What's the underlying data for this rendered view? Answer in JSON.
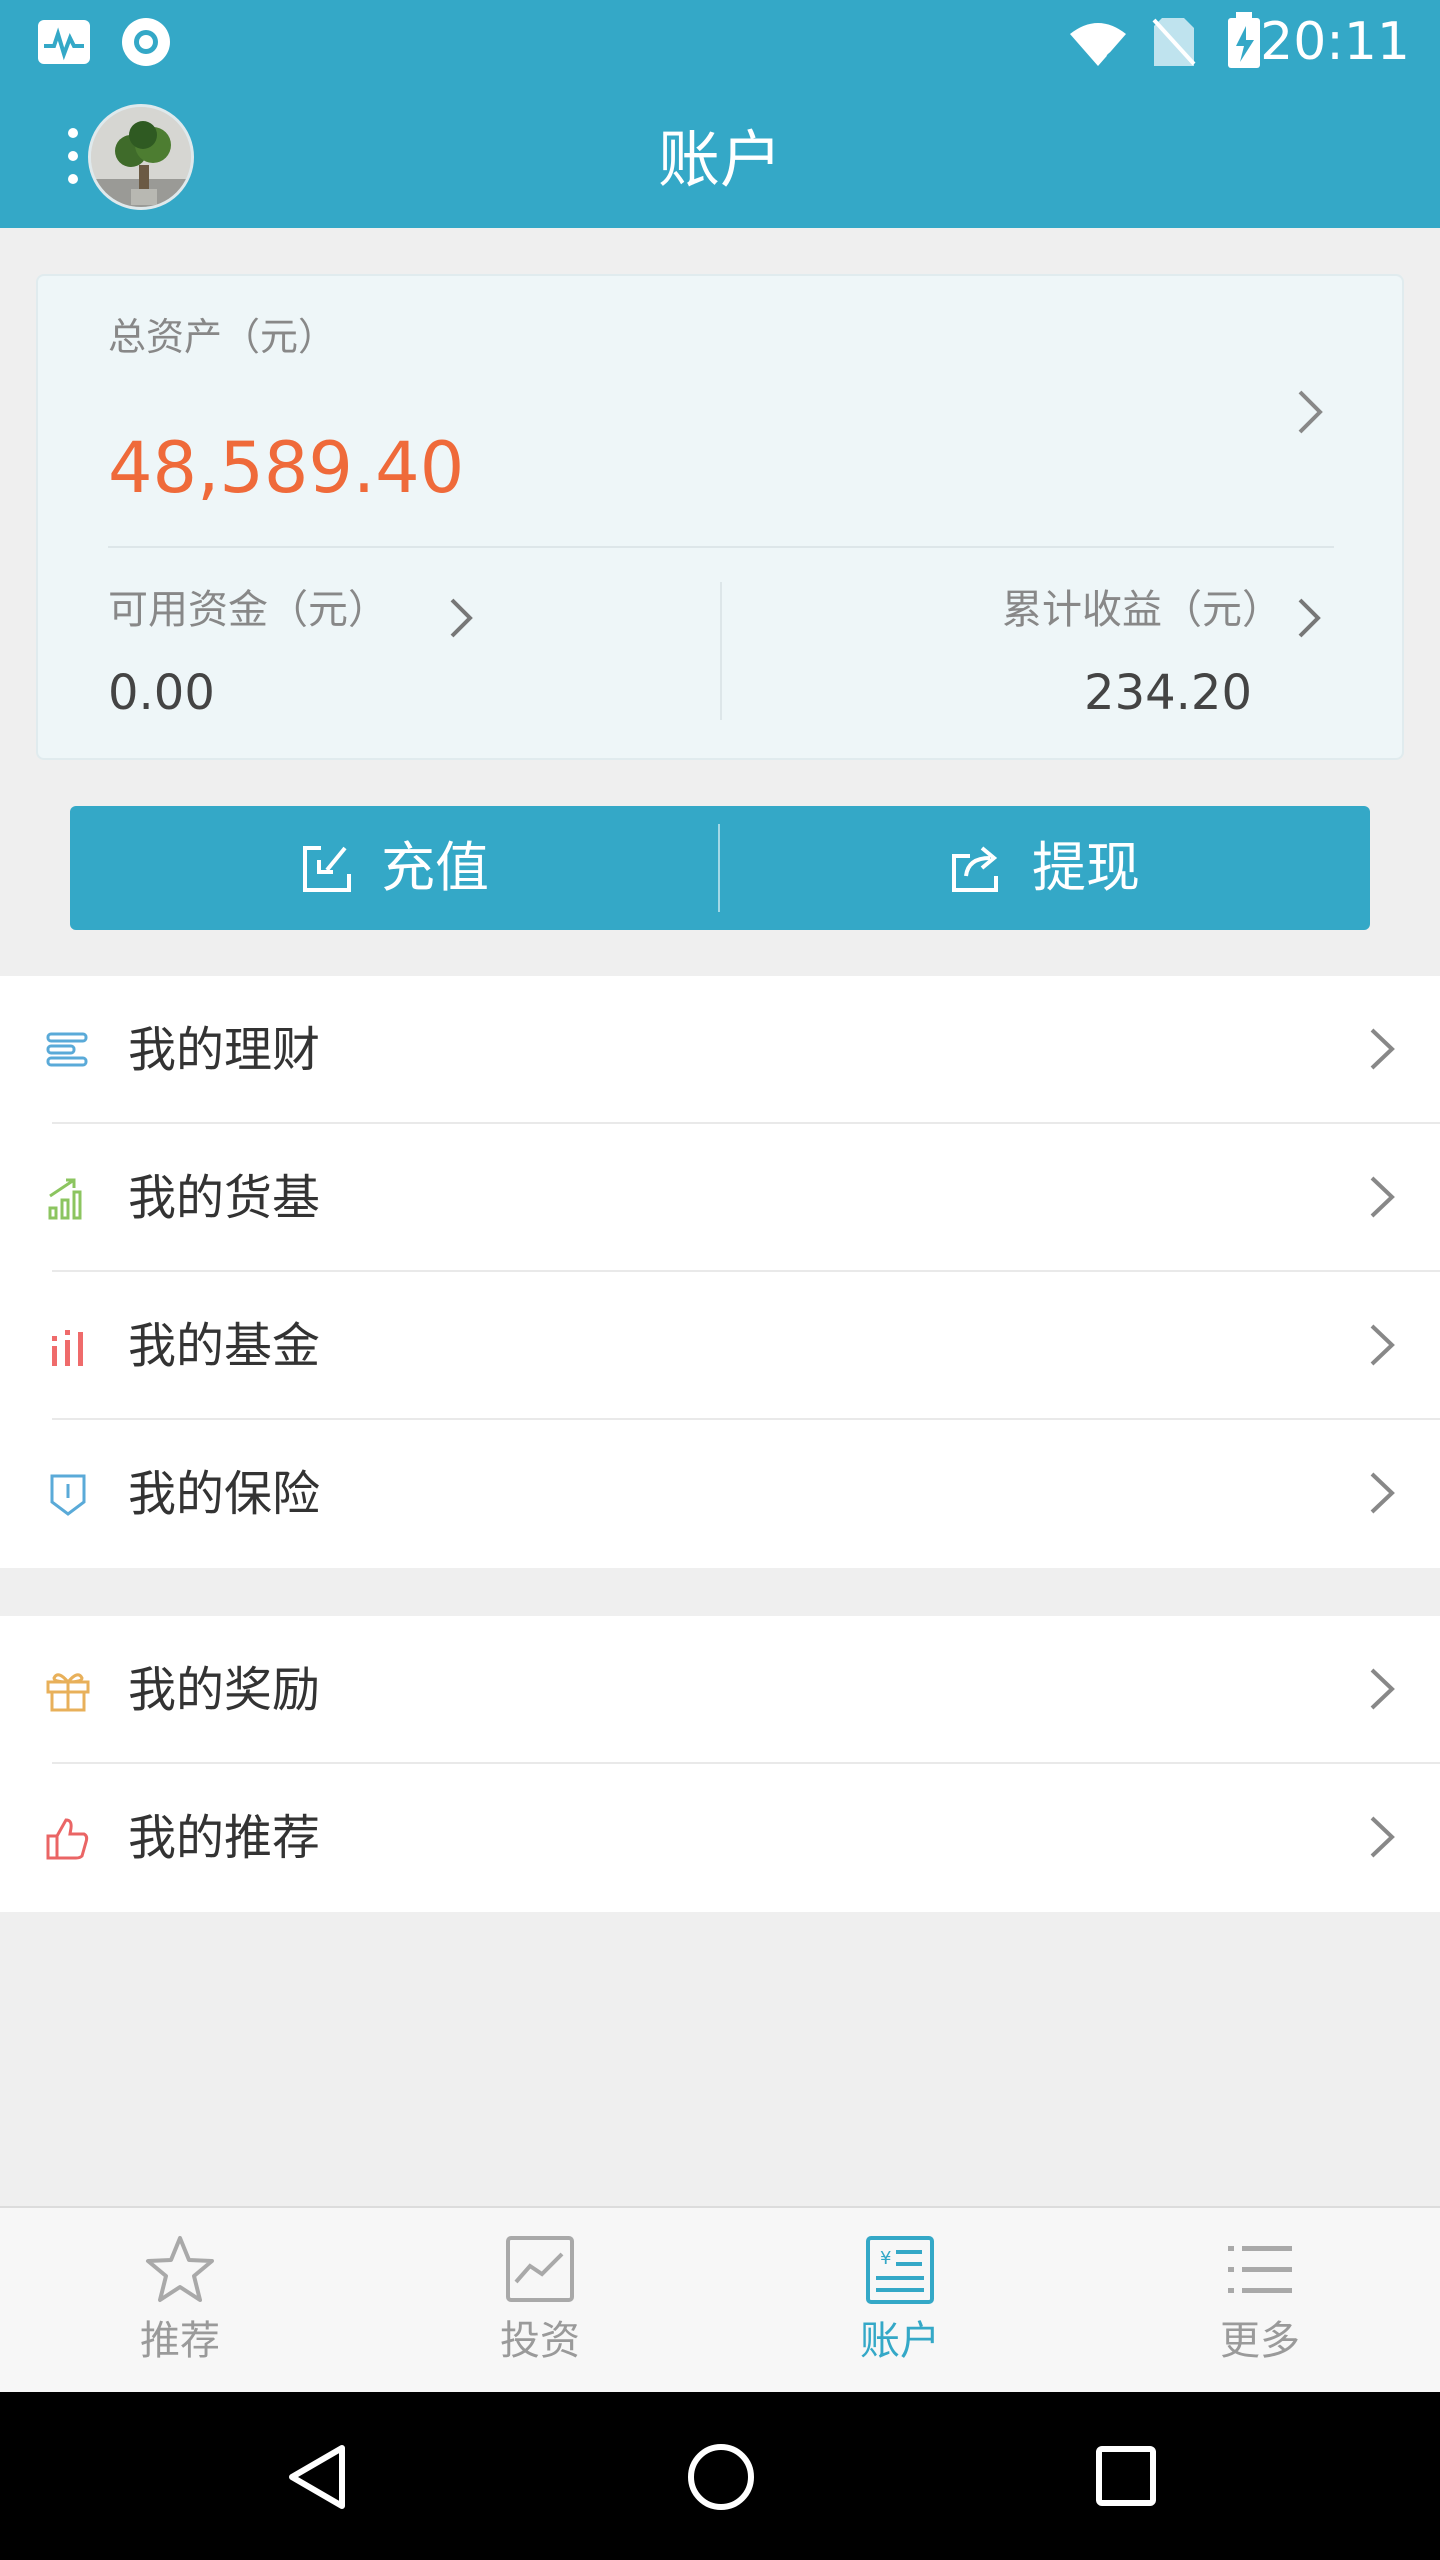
{
  "status_bar": {
    "time": "20:11",
    "icons": [
      "activity-icon",
      "circle-notification-icon",
      "wifi-off-icon",
      "no-sim-icon",
      "battery-charging-icon"
    ]
  },
  "app_bar": {
    "title": "账户",
    "icons": [
      "more-vert-icon",
      "avatar"
    ]
  },
  "asset_card": {
    "total_label": "总资产（元）",
    "total_value": "48,589.40",
    "available_label": "可用资金（元）",
    "available_value": "0.00",
    "earnings_label": "累计收益（元）",
    "earnings_value": "234.20"
  },
  "actions": {
    "deposit_label": "充值",
    "withdraw_label": "提现"
  },
  "menu_group_1": [
    {
      "label": "我的理财",
      "icon": "list-icon"
    },
    {
      "label": "我的货基",
      "icon": "bar-growth-icon"
    },
    {
      "label": "我的基金",
      "icon": "bars-icon"
    },
    {
      "label": "我的保险",
      "icon": "shield-icon"
    }
  ],
  "menu_group_2": [
    {
      "label": "我的奖励",
      "icon": "gift-icon"
    },
    {
      "label": "我的推荐",
      "icon": "thumbs-up-icon"
    }
  ],
  "tabs": [
    {
      "label": "推荐",
      "icon": "star-icon",
      "active": false
    },
    {
      "label": "投资",
      "icon": "chart-icon",
      "active": false
    },
    {
      "label": "账户",
      "icon": "account-book-icon",
      "active": true
    },
    {
      "label": "更多",
      "icon": "list-more-icon",
      "active": false
    }
  ],
  "colors": {
    "brand": "#34a8c7",
    "accent_orange": "#ef6a3a",
    "card_bg": "#eef6f8"
  }
}
